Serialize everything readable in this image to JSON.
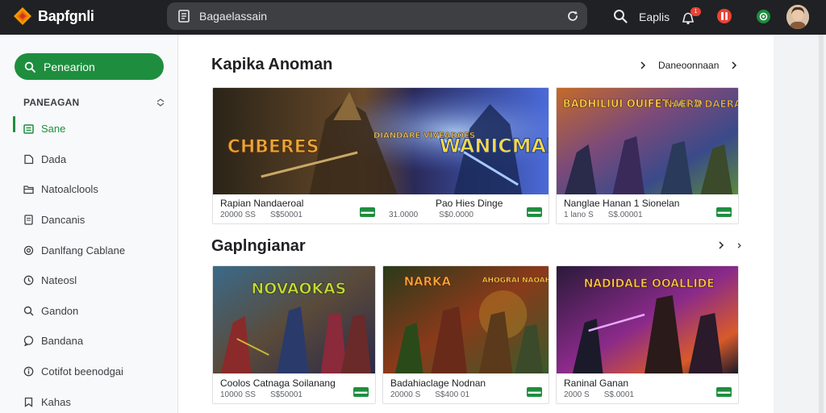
{
  "app": {
    "name": "Bapfgnli"
  },
  "search": {
    "value": "Bagaelassain"
  },
  "topbar": {
    "search_label": "Eaplis",
    "badge_count": "1"
  },
  "sidebar": {
    "search_button": "Penearion",
    "section_label": "PANEAGAN",
    "items": [
      {
        "label": "Sane",
        "icon": "store-icon"
      },
      {
        "label": "Dada",
        "icon": "tag-icon"
      },
      {
        "label": "Natoalclools",
        "icon": "folder-icon"
      },
      {
        "label": "Dancanis",
        "icon": "document-icon"
      },
      {
        "label": "Danlfang Cablane",
        "icon": "gear-icon"
      },
      {
        "label": "Nateosl",
        "icon": "clock-icon"
      },
      {
        "label": "Gandon",
        "icon": "search-icon"
      },
      {
        "label": "Bandana",
        "icon": "chat-icon"
      },
      {
        "label": "Cotifot beenodgai",
        "icon": "info-icon"
      },
      {
        "label": "Kahas",
        "icon": "bookmark-icon"
      }
    ]
  },
  "sections": [
    {
      "title": "Kapika Anoman",
      "nav_label": "Daneoonnaan",
      "cards": [
        {
          "title": "Rapian Nandaeroal",
          "meta": "20000 SS",
          "price": "S$50001",
          "art_labels": [
            "CHBERES",
            "DIANDARE VIVEADOES",
            "WANICMAN"
          ],
          "colors": [
            "#2a2418",
            "#6a4a2a",
            "#1a2a66",
            "#4a6ad8"
          ]
        },
        {
          "title": "Pao Hies Dinge",
          "meta": "31.0000",
          "price": "S$0.0000",
          "art_labels": [],
          "colors": [],
          "join": true
        },
        {
          "title": "Nanglae Hanan 1 Sionelan",
          "meta": "1 lano S",
          "price": "S$.00001",
          "art_labels": [
            "BADHILIUI OUIFETHARD",
            "NAERA DAERAS"
          ],
          "colors": [
            "#c46a2a",
            "#3a4a8a",
            "#7a4a7a",
            "#5a8a3a"
          ]
        }
      ]
    },
    {
      "title": "Gaplngianar",
      "nav_label": "",
      "cards": [
        {
          "title": "Coolos Catnaga Soilanang",
          "meta": "10000 SS",
          "price": "S$50001",
          "art_labels": [
            "NOVAOKAS"
          ],
          "colors": [
            "#3a6a8a",
            "#8a2a2a",
            "#c8b838",
            "#2a2a4a"
          ]
        },
        {
          "title": "Badahiaclage Nodnan",
          "meta": "20000 S",
          "price": "S$400 01",
          "art_labels": [
            "NARKA",
            "AHOGRAI NAOAHOA"
          ],
          "colors": [
            "#2a3a1a",
            "#8a3a1a",
            "#c89a2a",
            "#3a5a2a"
          ]
        },
        {
          "title": "Raninal Ganan",
          "meta": "2000 S",
          "price": "S$.0001",
          "art_labels": [
            "NADIDALE OOALLIDE"
          ],
          "colors": [
            "#2a1a3a",
            "#8a2a8a",
            "#d85a2a",
            "#1a1a2a"
          ]
        }
      ]
    }
  ],
  "theme": {
    "accent": "#1e8e3e",
    "topbar_bg": "#202124",
    "badge": "#ea4335"
  }
}
